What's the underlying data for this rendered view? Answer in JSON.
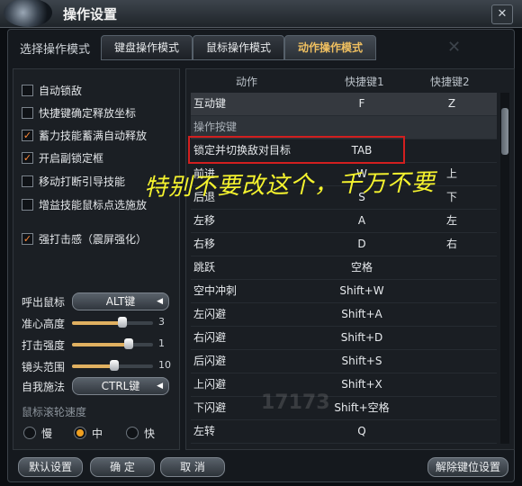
{
  "window": {
    "title": "操作设置",
    "close_icon": "close-icon"
  },
  "mode": {
    "label": "选择操作模式",
    "tabs": [
      {
        "label": "键盘操作模式",
        "active": false
      },
      {
        "label": "鼠标操作模式",
        "active": false
      },
      {
        "label": "动作操作模式",
        "active": true
      }
    ]
  },
  "options": {
    "checkboxes": [
      {
        "label": "自动锁敌",
        "checked": false
      },
      {
        "label": "快捷键确定释放坐标",
        "checked": false
      },
      {
        "label": "蓄力技能蓄满自动释放",
        "checked": true
      },
      {
        "label": "开启副锁定框",
        "checked": true
      },
      {
        "label": "移动打断引导技能",
        "checked": false
      },
      {
        "label": "增益技能鼠标点选施放",
        "checked": false
      },
      {
        "label": "强打击感（震屏强化）",
        "checked": true
      }
    ],
    "call_mouse": {
      "label": "呼出鼠标",
      "value": "ALT键"
    },
    "sliders": [
      {
        "label": "准心高度",
        "value": 3,
        "fraction": 0.62
      },
      {
        "label": "打击强度",
        "value": 1,
        "fraction": 0.7
      },
      {
        "label": "镜头范围",
        "value": 10,
        "fraction": 0.52
      }
    ],
    "self_cast": {
      "label": "自我施法",
      "value": "CTRL键"
    },
    "wheel_speed": {
      "label": "鼠标滚轮速度",
      "choices": [
        {
          "label": "慢",
          "selected": false
        },
        {
          "label": "中",
          "selected": true
        },
        {
          "label": "快",
          "selected": false
        }
      ]
    }
  },
  "keybinds": {
    "headers": {
      "action": "动作",
      "key1": "快捷键1",
      "key2": "快捷键2"
    },
    "rows": [
      {
        "action": "互动键",
        "key1": "F",
        "key2": "Z",
        "type": "hl"
      },
      {
        "action": "操作按键",
        "key1": "",
        "key2": "",
        "type": "header"
      },
      {
        "action": "锁定并切换敌对目标",
        "key1": "TAB",
        "key2": "",
        "type": ""
      },
      {
        "action": "前进",
        "key1": "W",
        "key2": "上",
        "type": ""
      },
      {
        "action": "后退",
        "key1": "S",
        "key2": "下",
        "type": ""
      },
      {
        "action": "左移",
        "key1": "A",
        "key2": "左",
        "type": ""
      },
      {
        "action": "右移",
        "key1": "D",
        "key2": "右",
        "type": ""
      },
      {
        "action": "跳跃",
        "key1": "空格",
        "key2": "",
        "type": ""
      },
      {
        "action": "空中冲刺",
        "key1": "Shift+W",
        "key2": "",
        "type": ""
      },
      {
        "action": "左闪避",
        "key1": "Shift+A",
        "key2": "",
        "type": ""
      },
      {
        "action": "右闪避",
        "key1": "Shift+D",
        "key2": "",
        "type": ""
      },
      {
        "action": "后闪避",
        "key1": "Shift+S",
        "key2": "",
        "type": ""
      },
      {
        "action": "上闪避",
        "key1": "Shift+X",
        "key2": "",
        "type": ""
      },
      {
        "action": "下闪避",
        "key1": "Shift+空格",
        "key2": "",
        "type": ""
      },
      {
        "action": "左转",
        "key1": "Q",
        "key2": "",
        "type": ""
      },
      {
        "action": "",
        "key1": "",
        "key2": "",
        "type": ""
      }
    ]
  },
  "annotation": {
    "text": "特别不要改这个，千万不要"
  },
  "watermark": {
    "text": "17173"
  },
  "buttons": {
    "default": "默认设置",
    "ok": "确 定",
    "cancel": "取 消",
    "unbind": "解除键位设置"
  },
  "colors": {
    "accent": "#f0c060",
    "highlight_box": "#d21f1f",
    "annotation": "#f5f32e"
  }
}
